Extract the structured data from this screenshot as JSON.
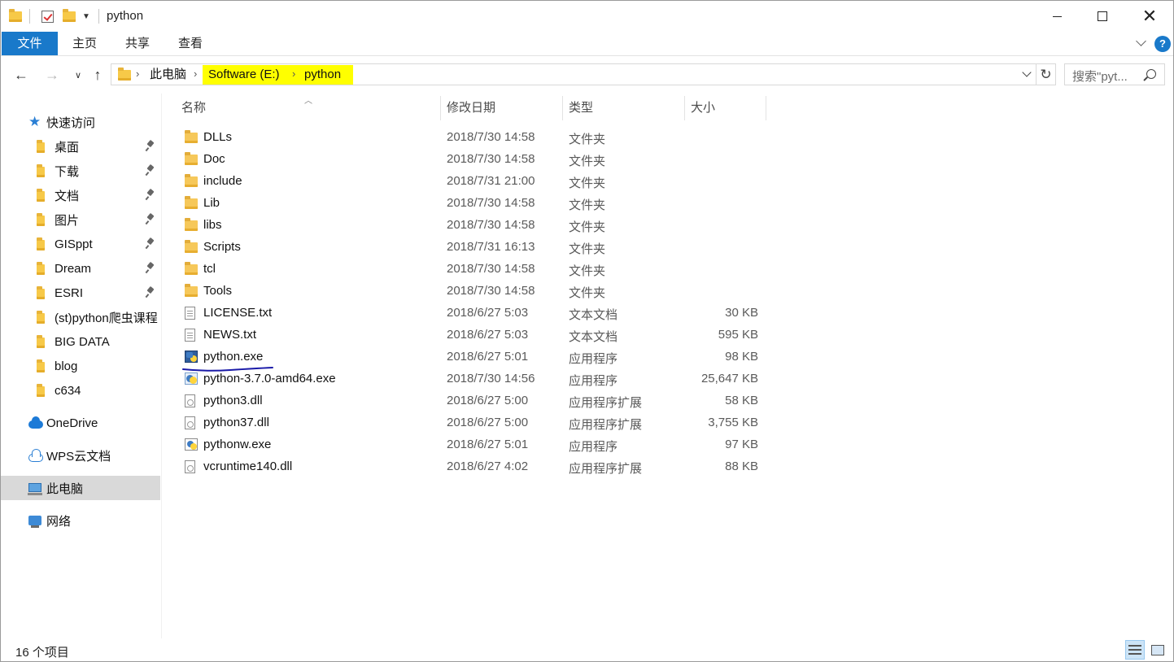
{
  "window": {
    "title": "python",
    "controls": {
      "minimize": "minimize",
      "maximize": "maximize",
      "close": "close"
    }
  },
  "ribbon": {
    "tabs": [
      "文件",
      "主页",
      "共享",
      "查看"
    ],
    "help": "?"
  },
  "address": {
    "crumbs": [
      "此电脑",
      "Software (E:)",
      "python"
    ],
    "highlight_color": "#ffff00"
  },
  "search": {
    "placeholder": "搜索\"pyt..."
  },
  "sidebar": {
    "items": [
      {
        "label": "快速访问",
        "icon": "star-icon"
      },
      {
        "label": "桌面",
        "icon": "desktop-folder-icon",
        "pinned": true
      },
      {
        "label": "下载",
        "icon": "download-folder-icon",
        "pinned": true
      },
      {
        "label": "文档",
        "icon": "documents-folder-icon",
        "pinned": true
      },
      {
        "label": "图片",
        "icon": "pictures-folder-icon",
        "pinned": true
      },
      {
        "label": "GISppt",
        "icon": "folder-icon",
        "pinned": true
      },
      {
        "label": "Dream",
        "icon": "folder-icon",
        "pinned": true
      },
      {
        "label": "ESRI",
        "icon": "folder-icon",
        "pinned": true
      },
      {
        "label": "(st)python爬虫课程",
        "icon": "folder-icon"
      },
      {
        "label": "BIG DATA",
        "icon": "folder-icon"
      },
      {
        "label": "blog",
        "icon": "folder-icon"
      },
      {
        "label": "c634",
        "icon": "folder-icon"
      },
      {
        "label": "OneDrive",
        "icon": "onedrive-cloud-icon"
      },
      {
        "label": "WPS云文档",
        "icon": "wps-cloud-icon"
      },
      {
        "label": "此电脑",
        "icon": "this-pc-icon",
        "selected": true
      },
      {
        "label": "网络",
        "icon": "network-icon"
      }
    ]
  },
  "columns": {
    "name": "名称",
    "date": "修改日期",
    "type": "类型",
    "size": "大小"
  },
  "files": [
    {
      "name": "DLLs",
      "date": "2018/7/30 14:58",
      "type": "文件夹",
      "size": "",
      "icon": "folder-icon"
    },
    {
      "name": "Doc",
      "date": "2018/7/30 14:58",
      "type": "文件夹",
      "size": "",
      "icon": "folder-icon"
    },
    {
      "name": "include",
      "date": "2018/7/31 21:00",
      "type": "文件夹",
      "size": "",
      "icon": "folder-icon"
    },
    {
      "name": "Lib",
      "date": "2018/7/30 14:58",
      "type": "文件夹",
      "size": "",
      "icon": "folder-icon"
    },
    {
      "name": "libs",
      "date": "2018/7/30 14:58",
      "type": "文件夹",
      "size": "",
      "icon": "folder-icon"
    },
    {
      "name": "Scripts",
      "date": "2018/7/31 16:13",
      "type": "文件夹",
      "size": "",
      "icon": "folder-icon"
    },
    {
      "name": "tcl",
      "date": "2018/7/30 14:58",
      "type": "文件夹",
      "size": "",
      "icon": "folder-icon"
    },
    {
      "name": "Tools",
      "date": "2018/7/30 14:58",
      "type": "文件夹",
      "size": "",
      "icon": "folder-icon"
    },
    {
      "name": "LICENSE.txt",
      "date": "2018/6/27 5:03",
      "type": "文本文档",
      "size": "30 KB",
      "icon": "text-file-icon"
    },
    {
      "name": "NEWS.txt",
      "date": "2018/6/27 5:03",
      "type": "文本文档",
      "size": "595 KB",
      "icon": "text-file-icon"
    },
    {
      "name": "python.exe",
      "date": "2018/6/27 5:01",
      "type": "应用程序",
      "size": "98 KB",
      "icon": "python-exe-icon"
    },
    {
      "name": "python-3.7.0-amd64.exe",
      "date": "2018/7/30 14:56",
      "type": "应用程序",
      "size": "25,647 KB",
      "icon": "installer-icon"
    },
    {
      "name": "python3.dll",
      "date": "2018/6/27 5:00",
      "type": "应用程序扩展",
      "size": "58 KB",
      "icon": "dll-file-icon"
    },
    {
      "name": "python37.dll",
      "date": "2018/6/27 5:00",
      "type": "应用程序扩展",
      "size": "3,755 KB",
      "icon": "dll-file-icon"
    },
    {
      "name": "pythonw.exe",
      "date": "2018/6/27 5:01",
      "type": "应用程序",
      "size": "97 KB",
      "icon": "pythonw-exe-icon"
    },
    {
      "name": "vcruntime140.dll",
      "date": "2018/6/27 4:02",
      "type": "应用程序扩展",
      "size": "88 KB",
      "icon": "dll-file-icon"
    }
  ],
  "status": {
    "item_count": "16 个项目"
  },
  "colors": {
    "accent": "#1979ca",
    "selected_nav": "#d9d9d9",
    "annotation": "#1a1aa8"
  }
}
